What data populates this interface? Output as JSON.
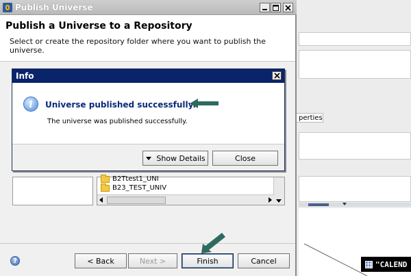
{
  "window": {
    "title": "Publish Universe"
  },
  "header": {
    "title": "Publish a Universe to a Repository",
    "description": "Select or create the repository folder where you want to publish the universe."
  },
  "folders": [
    {
      "label": "B2Ttest1_UNI"
    },
    {
      "label": "B23_TEST_UNIV"
    }
  ],
  "info_dialog": {
    "title": "Info",
    "headline": "Universe published successfully.",
    "message": "The universe was published successfully.",
    "show_details_label": "Show Details",
    "close_label": "Close"
  },
  "footer": {
    "back_label": "< Back",
    "next_label": "Next >",
    "finish_label": "Finish",
    "cancel_label": "Cancel"
  },
  "background_app": {
    "properties_tab": "perties",
    "calendar_label": "\"CALEND"
  },
  "colors": {
    "dialog_titlebar": "#0a246a",
    "headline_text": "#0a2a7a",
    "callout_arrow": "#2e6b5e"
  },
  "icons": {
    "app": "publish-universe-app-icon",
    "info": "info-icon",
    "help": "help-icon",
    "folder": "folder-icon",
    "callout": "callout-arrow-icon",
    "table": "table-grid-icon"
  }
}
